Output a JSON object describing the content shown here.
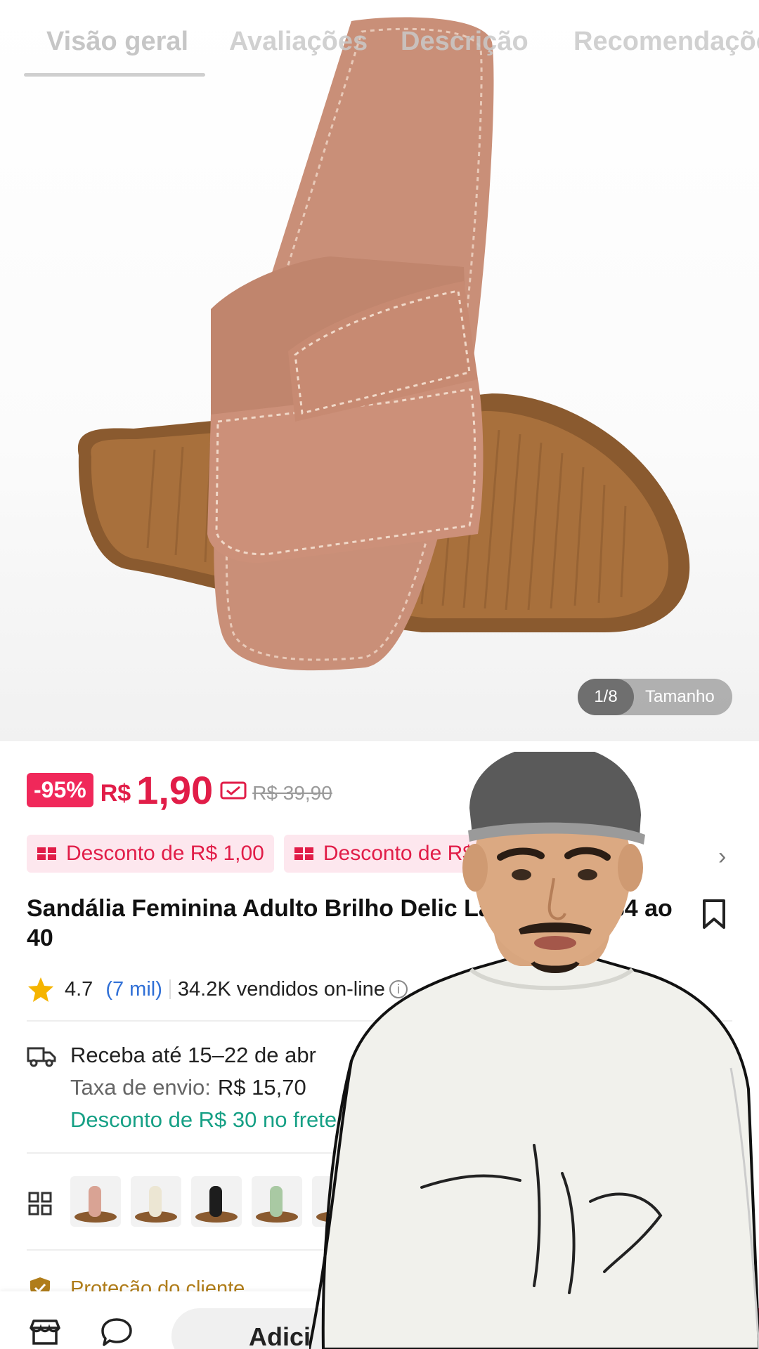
{
  "tabs": [
    "Visão geral",
    "Avaliações",
    "Descrição",
    "Recomendações"
  ],
  "image_counter": {
    "current": "1/8",
    "label": "Tamanho"
  },
  "price": {
    "discount_badge": "-95%",
    "currency": "R$",
    "value": "1,90",
    "old_price": "R$ 39,90"
  },
  "coupons": [
    "Desconto de R$ 1,00",
    "Desconto de R$"
  ],
  "product": {
    "title": "Sandália Feminina Adulto Brilho Delic Lançamento 34 ao 40",
    "rating": "4.7",
    "reviews": "(7 mil)",
    "sold": "34.2K vendidos on-line"
  },
  "shipping": {
    "delivery": "Receba até 15–22 de abr",
    "fee_label": "Taxa de envio:",
    "fee_value": "R$ 15,70",
    "discount": "Desconto de R$ 30 no frete"
  },
  "protection": "Proteção do cliente",
  "bottom": {
    "add_to_cart": "Adici"
  },
  "colors": {
    "accent": "#f0285a",
    "link": "#2f6fd6",
    "green": "#16a085"
  },
  "variant_colors": [
    "#d9a394",
    "#ece6d3",
    "#1d1d1d",
    "#a9c9a3",
    "#d8c6a0"
  ]
}
